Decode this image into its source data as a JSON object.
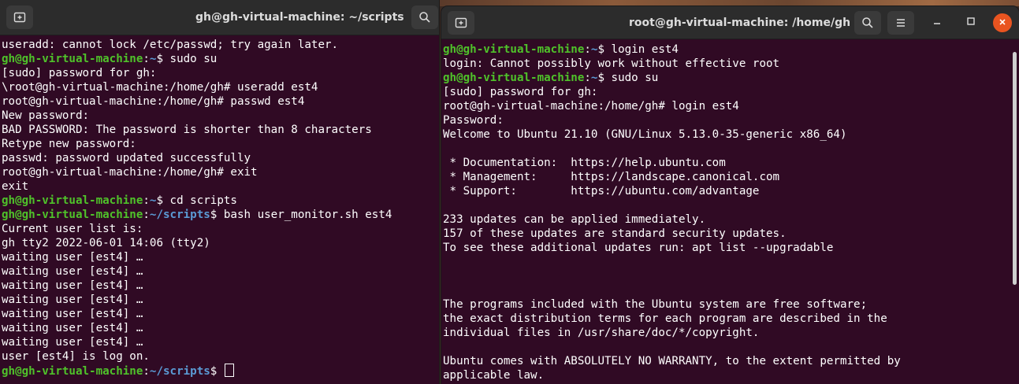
{
  "left_window": {
    "title": "gh@gh-virtual-machine: ~/scripts",
    "lines": [
      {
        "text": "useradd: cannot lock /etc/passwd; try again later."
      },
      {
        "user": "gh@gh-virtual-machine",
        "sep": ":",
        "path": "~",
        "cmd": "$ sudo su"
      },
      {
        "text": "[sudo] password for gh:"
      },
      {
        "text": "\\root@gh-virtual-machine:/home/gh# useradd est4"
      },
      {
        "text": "root@gh-virtual-machine:/home/gh# passwd est4"
      },
      {
        "text": "New password:"
      },
      {
        "text": "BAD PASSWORD: The password is shorter than 8 characters"
      },
      {
        "text": "Retype new password:"
      },
      {
        "text": "passwd: password updated successfully"
      },
      {
        "text": "root@gh-virtual-machine:/home/gh# exit"
      },
      {
        "text": "exit"
      },
      {
        "user": "gh@gh-virtual-machine",
        "sep": ":",
        "path": "~",
        "cmd": "$ cd scripts"
      },
      {
        "user": "gh@gh-virtual-machine",
        "sep": ":",
        "path": "~/scripts",
        "cmd": "$ bash user_monitor.sh est4"
      },
      {
        "text": "Current user list is:"
      },
      {
        "text": "gh tty2 2022-06-01 14:06 (tty2)"
      },
      {
        "text": "waiting user [est4] …"
      },
      {
        "text": "waiting user [est4] …"
      },
      {
        "text": "waiting user [est4] …"
      },
      {
        "text": "waiting user [est4] …"
      },
      {
        "text": "waiting user [est4] …"
      },
      {
        "text": "waiting user [est4] …"
      },
      {
        "text": "waiting user [est4] …"
      },
      {
        "text": "user [est4] is log on."
      },
      {
        "user": "gh@gh-virtual-machine",
        "sep": ":",
        "path": "~/scripts",
        "cmd": "$ ",
        "cursor": true
      }
    ]
  },
  "right_window": {
    "title": "root@gh-virtual-machine: /home/gh",
    "lines": [
      {
        "user": "gh@gh-virtual-machine",
        "sep": ":",
        "path": "~",
        "cmd": "$ login est4"
      },
      {
        "text": "login: Cannot possibly work without effective root"
      },
      {
        "user": "gh@gh-virtual-machine",
        "sep": ":",
        "path": "~",
        "cmd": "$ sudo su"
      },
      {
        "text": "[sudo] password for gh:"
      },
      {
        "text": "root@gh-virtual-machine:/home/gh# login est4"
      },
      {
        "text": "Password:"
      },
      {
        "text": "Welcome to Ubuntu 21.10 (GNU/Linux 5.13.0-35-generic x86_64)"
      },
      {
        "text": ""
      },
      {
        "text": " * Documentation:  https://help.ubuntu.com"
      },
      {
        "text": " * Management:     https://landscape.canonical.com"
      },
      {
        "text": " * Support:        https://ubuntu.com/advantage"
      },
      {
        "text": ""
      },
      {
        "text": "233 updates can be applied immediately."
      },
      {
        "text": "157 of these updates are standard security updates."
      },
      {
        "text": "To see these additional updates run: apt list --upgradable"
      },
      {
        "text": ""
      },
      {
        "text": ""
      },
      {
        "text": ""
      },
      {
        "text": "The programs included with the Ubuntu system are free software;"
      },
      {
        "text": "the exact distribution terms for each program are described in the"
      },
      {
        "text": "individual files in /usr/share/doc/*/copyright."
      },
      {
        "text": ""
      },
      {
        "text": "Ubuntu comes with ABSOLUTELY NO WARRANTY, to the extent permitted by"
      },
      {
        "text": "applicable law."
      }
    ]
  },
  "icons": {
    "new_tab": "new-tab-icon",
    "search": "search-icon",
    "menu": "hamburger-menu-icon",
    "minimize": "minimize-icon",
    "maximize": "maximize-icon",
    "close": "close-icon"
  },
  "colors": {
    "terminal_bg": "#300a24",
    "prompt_user": "#4fc22a",
    "prompt_path": "#5b9bd5",
    "titlebar": "#2c2c2c",
    "close_button": "#e95420"
  }
}
